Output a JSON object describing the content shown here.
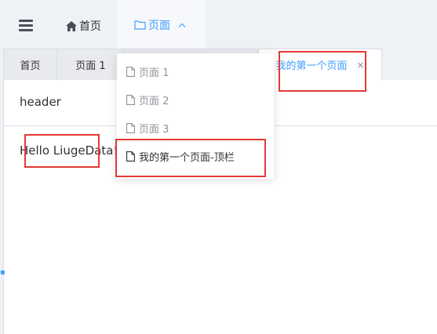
{
  "topbar": {
    "home_label": "首页",
    "pages_label": "页面"
  },
  "tabs": [
    {
      "label": "首页"
    },
    {
      "label": "页面 1"
    },
    {
      "label": ""
    },
    {
      "label": "我的第一个页面",
      "close": "×",
      "active": true
    }
  ],
  "panel": {
    "header": "header",
    "body": "Hello LiugeData!"
  },
  "dropdown": {
    "items": [
      {
        "label": "页面 1"
      },
      {
        "label": "页面 2"
      },
      {
        "label": "页面 3"
      },
      {
        "label": "我的第一个页面-顶栏"
      }
    ]
  },
  "colors": {
    "accent": "#409eff",
    "highlight": "#e53935",
    "nav_bg": "#eef1f6"
  },
  "icons": [
    "menu-icon",
    "home-icon",
    "folder-icon",
    "chevron-up-icon",
    "document-icon"
  ]
}
